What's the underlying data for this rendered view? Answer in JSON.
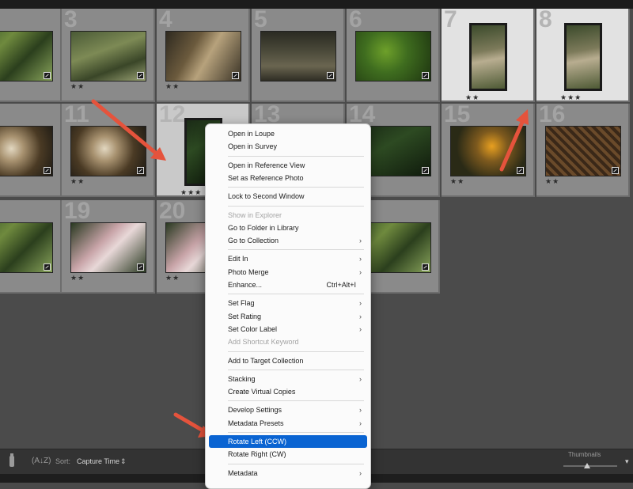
{
  "cells": [
    {
      "num": "",
      "stars": "",
      "tex": "t-green",
      "shape": "land"
    },
    {
      "num": "3",
      "stars": "★★",
      "tex": "t-lizard",
      "shape": "land"
    },
    {
      "num": "4",
      "stars": "★★",
      "tex": "t-mammal",
      "shape": "land"
    },
    {
      "num": "5",
      "stars": "",
      "tex": "t-pecc",
      "shape": "land"
    },
    {
      "num": "6",
      "stars": "",
      "tex": "t-leaf",
      "shape": "land"
    },
    {
      "num": "7",
      "stars": "★★",
      "tex": "t-sloth",
      "shape": "port"
    },
    {
      "num": "8",
      "stars": "★★★",
      "tex": "t-sloth",
      "shape": "port"
    },
    {
      "num": "",
      "stars": "",
      "tex": "t-monkey",
      "shape": "land"
    },
    {
      "num": "11",
      "stars": "★★",
      "tex": "t-monkey",
      "shape": "land"
    },
    {
      "num": "12",
      "stars": "★★★",
      "tex": "t-dark",
      "shape": "port"
    },
    {
      "num": "13",
      "stars": "",
      "tex": "t-dark",
      "shape": "land"
    },
    {
      "num": "14",
      "stars": "",
      "tex": "t-dark",
      "shape": "land"
    },
    {
      "num": "15",
      "stars": "★★",
      "tex": "t-orange",
      "shape": "land"
    },
    {
      "num": "16",
      "stars": "★★",
      "tex": "t-fence",
      "shape": "land"
    },
    {
      "num": "",
      "stars": "",
      "tex": "t-green",
      "shape": "land"
    },
    {
      "num": "19",
      "stars": "★★",
      "tex": "t-pink",
      "shape": "land"
    },
    {
      "num": "20",
      "stars": "★★",
      "tex": "t-pink",
      "shape": "land"
    },
    {
      "num": "",
      "stars": "",
      "tex": "t-dark",
      "shape": "land"
    },
    {
      "num": "",
      "stars": "★",
      "tex": "t-green",
      "shape": "land"
    }
  ],
  "toolbar": {
    "sort_label": "Sort:",
    "sort_value": "Capture Time",
    "thumbnails_label": "Thumbnails"
  },
  "context_menu": {
    "items": [
      {
        "label": "Open in Loupe",
        "shortcut": "",
        "submenu": false,
        "disabled": false,
        "highlighted": false
      },
      {
        "label": "Open in Survey",
        "shortcut": "",
        "submenu": false,
        "disabled": false,
        "highlighted": false
      },
      {
        "sep": true
      },
      {
        "label": "Open in Reference View",
        "shortcut": "",
        "submenu": false,
        "disabled": false,
        "highlighted": false
      },
      {
        "label": "Set as Reference Photo",
        "shortcut": "",
        "submenu": false,
        "disabled": false,
        "highlighted": false
      },
      {
        "sep": true
      },
      {
        "label": "Lock to Second Window",
        "shortcut": "",
        "submenu": false,
        "disabled": false,
        "highlighted": false
      },
      {
        "sep": true
      },
      {
        "label": "Show in Explorer",
        "shortcut": "",
        "submenu": false,
        "disabled": true,
        "highlighted": false
      },
      {
        "label": "Go to Folder in Library",
        "shortcut": "",
        "submenu": false,
        "disabled": false,
        "highlighted": false
      },
      {
        "label": "Go to Collection",
        "shortcut": "",
        "submenu": true,
        "disabled": false,
        "highlighted": false
      },
      {
        "sep": true
      },
      {
        "label": "Edit In",
        "shortcut": "",
        "submenu": true,
        "disabled": false,
        "highlighted": false
      },
      {
        "label": "Photo Merge",
        "shortcut": "",
        "submenu": true,
        "disabled": false,
        "highlighted": false
      },
      {
        "label": "Enhance...",
        "shortcut": "Ctrl+Alt+I",
        "submenu": false,
        "disabled": false,
        "highlighted": false
      },
      {
        "sep": true
      },
      {
        "label": "Set Flag",
        "shortcut": "",
        "submenu": true,
        "disabled": false,
        "highlighted": false
      },
      {
        "label": "Set Rating",
        "shortcut": "",
        "submenu": true,
        "disabled": false,
        "highlighted": false
      },
      {
        "label": "Set Color Label",
        "shortcut": "",
        "submenu": true,
        "disabled": false,
        "highlighted": false
      },
      {
        "label": "Add Shortcut Keyword",
        "shortcut": "",
        "submenu": false,
        "disabled": true,
        "highlighted": false
      },
      {
        "sep": true
      },
      {
        "label": "Add to Target Collection",
        "shortcut": "",
        "submenu": false,
        "disabled": false,
        "highlighted": false
      },
      {
        "sep": true
      },
      {
        "label": "Stacking",
        "shortcut": "",
        "submenu": true,
        "disabled": false,
        "highlighted": false
      },
      {
        "label": "Create Virtual Copies",
        "shortcut": "",
        "submenu": false,
        "disabled": false,
        "highlighted": false
      },
      {
        "sep": true
      },
      {
        "label": "Develop Settings",
        "shortcut": "",
        "submenu": true,
        "disabled": false,
        "highlighted": false
      },
      {
        "label": "Metadata Presets",
        "shortcut": "",
        "submenu": true,
        "disabled": false,
        "highlighted": false
      },
      {
        "sep": true
      },
      {
        "label": "Rotate Left (CCW)",
        "shortcut": "",
        "submenu": false,
        "disabled": false,
        "highlighted": true
      },
      {
        "label": "Rotate Right (CW)",
        "shortcut": "",
        "submenu": false,
        "disabled": false,
        "highlighted": false
      },
      {
        "sep": true
      },
      {
        "label": "Metadata",
        "shortcut": "",
        "submenu": true,
        "disabled": false,
        "highlighted": false
      }
    ]
  }
}
